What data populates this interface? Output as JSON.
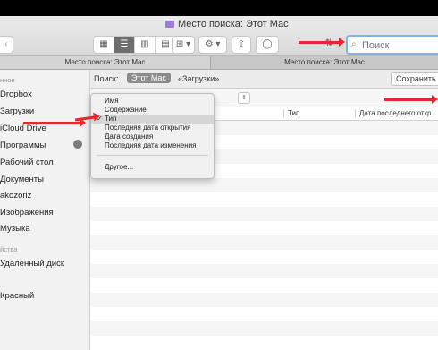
{
  "window": {
    "title": "Место поиска: Этот Mac"
  },
  "toolbar": {
    "back_glyph": "‹",
    "view_icons": [
      "▦",
      "☰",
      "▥",
      "▤"
    ],
    "group_icon": "⊞ ▾",
    "action_icon": "⚙ ▾",
    "share_icon": "⇧",
    "tag_icon": "◯",
    "arrange_icon": "⇅"
  },
  "search": {
    "placeholder": "Поиск",
    "icon": "magnifier-icon"
  },
  "tabs": [
    "Место поиска: Этот Mac",
    "Место поиска: Этот Mac"
  ],
  "sidebar": {
    "favorites_header": "нное",
    "items": [
      "Dropbox",
      "Загрузки",
      "iCloud Drive",
      "Программы",
      "Рабочий стол",
      "Документы",
      "akozoriz",
      "Изображения",
      "Музыка"
    ],
    "devices_header": "йства",
    "devices": [
      "Удаленный диск"
    ],
    "tags": [
      "Красный"
    ]
  },
  "scope": {
    "label": "Поиск:",
    "this_mac": "Этот Mac",
    "downloads": "«Загрузки»",
    "save": "Сохранить"
  },
  "columns": [
    "Тип",
    "Дата последнего откр"
  ],
  "menu": {
    "items": [
      "Имя",
      "Содержание",
      "Тип",
      "Последняя дата открытия",
      "Дата создания",
      "Последняя дата изменения"
    ],
    "selected_index": 2,
    "check": "✓",
    "other": "Другое..."
  },
  "colors": {
    "annotation_arrow": "#e8262c",
    "search_focus": "#7fb2f0"
  }
}
